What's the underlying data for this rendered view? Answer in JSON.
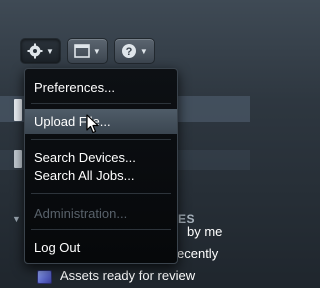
{
  "toolbar": {
    "buttons": [
      {
        "icon": "gear-icon",
        "has_menu": true
      },
      {
        "icon": "window-icon",
        "has_menu": true
      },
      {
        "icon": "help-icon",
        "has_menu": true
      }
    ]
  },
  "menu": {
    "items": [
      {
        "label": "Preferences...",
        "state": "normal"
      },
      {
        "label": "Upload File...",
        "state": "highlighted"
      },
      {
        "label": "Search Devices...",
        "state": "normal"
      },
      {
        "label": "Search All Jobs...",
        "state": "normal"
      },
      {
        "label": "Administration...",
        "state": "disabled"
      },
      {
        "label": "Log Out",
        "state": "normal"
      }
    ]
  },
  "background": {
    "section_heading": "ES",
    "items": [
      {
        "label": "by me"
      },
      {
        "label": "ecently"
      },
      {
        "label": "Assets ready for review"
      }
    ]
  },
  "colors": {
    "menu_background": "#0a0d10",
    "highlight": "#485561",
    "disabled_text": "#58616a",
    "toolbar_button": "#4b5560"
  }
}
